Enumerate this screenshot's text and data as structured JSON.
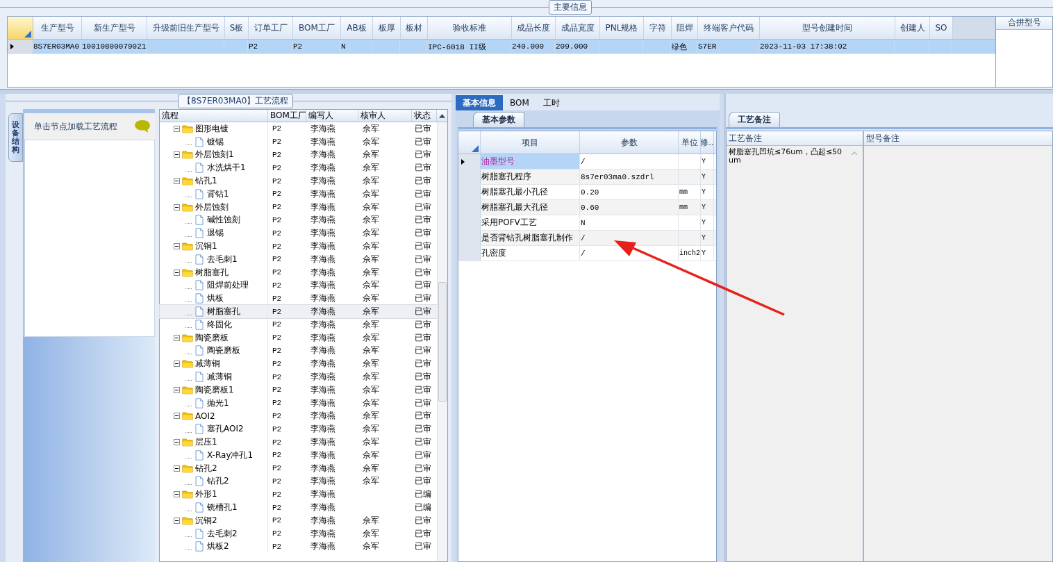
{
  "main_info": {
    "title": "主要信息",
    "columns": [
      "生产型号",
      "新生产型号",
      "升级前旧生产型号",
      "S板",
      "订单工厂",
      "BOM工厂",
      "AB板",
      "板厚",
      "板材",
      "验收标准",
      "成品长度",
      "成品宽度",
      "PNL规格",
      "字符",
      "阻焊",
      "终端客户代码",
      "型号创建时间",
      "创建人",
      "SO"
    ],
    "rows": [
      {
        "selected": true,
        "cells": [
          "8S7ER03MA0",
          "10010800079021",
          "",
          "",
          "P2",
          "P2",
          "N",
          "",
          "",
          "IPC-6018 II级",
          "240.000",
          "209.000",
          "",
          "",
          "绿色",
          "S7ER",
          "2023-11-03 17:38:02",
          "",
          ""
        ]
      }
    ],
    "side_title": "合拼型号"
  },
  "process": {
    "title": "【8S7ER03MA0】工艺流程",
    "side_tab": "设备结构",
    "hint": "单击节点加载工艺流程",
    "columns": [
      "流程",
      "BOM工厂",
      "编写人",
      "核审人",
      "状态"
    ],
    "tree": [
      {
        "name": "图形电镀",
        "bom": "P2",
        "writer": "李海燕",
        "reviewer": "佘军",
        "status": "已审",
        "expanded": true,
        "selected": false,
        "children": [
          {
            "name": "镀锡",
            "bom": "P2",
            "writer": "李海燕",
            "reviewer": "佘军",
            "status": "已审",
            "selected": false
          }
        ]
      },
      {
        "name": "外层蚀刻1",
        "bom": "P2",
        "writer": "李海燕",
        "reviewer": "佘军",
        "status": "已审",
        "expanded": true,
        "selected": false,
        "children": [
          {
            "name": "水洗烘干1",
            "bom": "P2",
            "writer": "李海燕",
            "reviewer": "佘军",
            "status": "已审",
            "selected": false
          }
        ]
      },
      {
        "name": "钻孔1",
        "bom": "P2",
        "writer": "李海燕",
        "reviewer": "佘军",
        "status": "已审",
        "expanded": true,
        "selected": false,
        "children": [
          {
            "name": "背钻1",
            "bom": "P2",
            "writer": "李海燕",
            "reviewer": "佘军",
            "status": "已审",
            "selected": false
          }
        ]
      },
      {
        "name": "外层蚀刻",
        "bom": "P2",
        "writer": "李海燕",
        "reviewer": "佘军",
        "status": "已审",
        "expanded": true,
        "selected": false,
        "children": [
          {
            "name": "碱性蚀刻",
            "bom": "P2",
            "writer": "李海燕",
            "reviewer": "佘军",
            "status": "已审",
            "selected": false
          },
          {
            "name": "退锡",
            "bom": "P2",
            "writer": "李海燕",
            "reviewer": "佘军",
            "status": "已审",
            "selected": false
          }
        ]
      },
      {
        "name": "沉铜1",
        "bom": "P2",
        "writer": "李海燕",
        "reviewer": "佘军",
        "status": "已审",
        "expanded": true,
        "selected": false,
        "children": [
          {
            "name": "去毛刺1",
            "bom": "P2",
            "writer": "李海燕",
            "reviewer": "佘军",
            "status": "已审",
            "selected": false
          }
        ]
      },
      {
        "name": "树脂塞孔",
        "bom": "P2",
        "writer": "李海燕",
        "reviewer": "佘军",
        "status": "已审",
        "expanded": true,
        "selected": false,
        "children": [
          {
            "name": "阻焊前处理",
            "bom": "P2",
            "writer": "李海燕",
            "reviewer": "佘军",
            "status": "已审",
            "selected": false
          },
          {
            "name": "烘板",
            "bom": "P2",
            "writer": "李海燕",
            "reviewer": "佘军",
            "status": "已审",
            "selected": false
          },
          {
            "name": "树脂塞孔",
            "bom": "P2",
            "writer": "李海燕",
            "reviewer": "佘军",
            "status": "已审",
            "selected": true
          },
          {
            "name": "终固化",
            "bom": "P2",
            "writer": "李海燕",
            "reviewer": "佘军",
            "status": "已审",
            "selected": false
          }
        ]
      },
      {
        "name": "陶瓷磨板",
        "bom": "P2",
        "writer": "李海燕",
        "reviewer": "佘军",
        "status": "已审",
        "expanded": true,
        "selected": false,
        "children": [
          {
            "name": "陶瓷磨板",
            "bom": "P2",
            "writer": "李海燕",
            "reviewer": "佘军",
            "status": "已审",
            "selected": false
          }
        ]
      },
      {
        "name": "减薄铜",
        "bom": "P2",
        "writer": "李海燕",
        "reviewer": "佘军",
        "status": "已审",
        "expanded": true,
        "selected": false,
        "children": [
          {
            "name": "减薄铜",
            "bom": "P2",
            "writer": "李海燕",
            "reviewer": "佘军",
            "status": "已审",
            "selected": false
          }
        ]
      },
      {
        "name": "陶瓷磨板1",
        "bom": "P2",
        "writer": "李海燕",
        "reviewer": "佘军",
        "status": "已审",
        "expanded": true,
        "selected": false,
        "children": [
          {
            "name": "抛光1",
            "bom": "P2",
            "writer": "李海燕",
            "reviewer": "佘军",
            "status": "已审",
            "selected": false
          }
        ]
      },
      {
        "name": "AOI2",
        "bom": "P2",
        "writer": "李海燕",
        "reviewer": "佘军",
        "status": "已审",
        "expanded": true,
        "selected": false,
        "children": [
          {
            "name": "塞孔AOI2",
            "bom": "P2",
            "writer": "李海燕",
            "reviewer": "佘军",
            "status": "已审",
            "selected": false
          }
        ]
      },
      {
        "name": "层压1",
        "bom": "P2",
        "writer": "李海燕",
        "reviewer": "佘军",
        "status": "已审",
        "expanded": true,
        "selected": false,
        "children": [
          {
            "name": "X-Ray冲孔1",
            "bom": "P2",
            "writer": "李海燕",
            "reviewer": "佘军",
            "status": "已审",
            "selected": false
          }
        ]
      },
      {
        "name": "钻孔2",
        "bom": "P2",
        "writer": "李海燕",
        "reviewer": "佘军",
        "status": "已审",
        "expanded": true,
        "selected": false,
        "children": [
          {
            "name": "钻孔2",
            "bom": "P2",
            "writer": "李海燕",
            "reviewer": "佘军",
            "status": "已审",
            "selected": false
          }
        ]
      },
      {
        "name": "外形1",
        "bom": "P2",
        "writer": "李海燕",
        "status": "已编",
        "expanded": true,
        "selected": false,
        "children": [
          {
            "name": "铣槽孔1",
            "bom": "P2",
            "writer": "李海燕",
            "status": "已编",
            "selected": false
          }
        ]
      },
      {
        "name": "沉铜2",
        "bom": "P2",
        "writer": "李海燕",
        "reviewer": "佘军",
        "status": "已审",
        "expanded": true,
        "selected": false,
        "children": [
          {
            "name": "去毛刺2",
            "bom": "P2",
            "writer": "李海燕",
            "reviewer": "佘军",
            "status": "已审",
            "selected": false
          },
          {
            "name": "烘板2",
            "bom": "P2",
            "writer": "李海燕",
            "reviewer": "佘军",
            "status": "已审",
            "selected": false
          }
        ]
      }
    ]
  },
  "detail_tabs": [
    {
      "label": "基本信息",
      "selected": true
    },
    {
      "label": "BOM",
      "selected": false
    },
    {
      "label": "工时",
      "selected": false
    }
  ],
  "params": {
    "tab": "基本参数",
    "columns": [
      "项目",
      "参数",
      "单位",
      "修.."
    ],
    "rows": [
      {
        "item": "油墨型号",
        "value": "/",
        "unit": "",
        "flag": "Y",
        "selected": true
      },
      {
        "item": "树脂塞孔程序",
        "value": "8s7er03ma0.szdrl",
        "unit": "",
        "flag": "Y",
        "selected": false
      },
      {
        "item": "树脂塞孔最小孔径",
        "value": "0.20",
        "unit": "mm",
        "flag": "Y",
        "selected": false
      },
      {
        "item": "树脂塞孔最大孔径",
        "value": "0.60",
        "unit": "mm",
        "flag": "Y",
        "selected": false
      },
      {
        "item": "采用POFV工艺",
        "value": "N",
        "unit": "",
        "flag": "Y",
        "selected": false
      },
      {
        "item": "是否背钻孔树脂塞孔制作",
        "value": "/",
        "unit": "",
        "flag": "Y",
        "selected": false
      },
      {
        "item": "孔密度",
        "value": "/",
        "unit": "inch2",
        "flag": "Y",
        "selected": false
      }
    ]
  },
  "notes": {
    "tab": "工艺备注",
    "columns": [
      "工艺备注",
      "型号备注"
    ],
    "process_note": "树脂塞孔凹坑≤76um，凸起≤50um"
  }
}
